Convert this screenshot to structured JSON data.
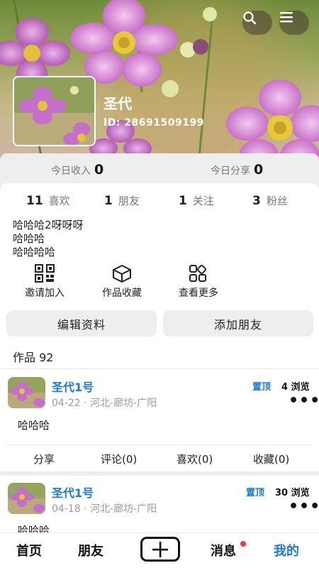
{
  "header": {
    "user_name": "圣代",
    "user_id": "ID: 28691509199",
    "icons": {
      "search": "search-icon",
      "menu": "hamburger-menu-icon"
    }
  },
  "stats": {
    "income_label": "今日收入",
    "income_value": "0",
    "share_label": "今日分享",
    "share_value": "0"
  },
  "counts": [
    {
      "value": "11",
      "label": "喜欢"
    },
    {
      "value": "1",
      "label": "朋友"
    },
    {
      "value": "1",
      "label": "关注"
    },
    {
      "value": "3",
      "label": "粉丝"
    }
  ],
  "bio": [
    "哈哈哈2呀呀呀",
    "哈哈哈",
    "哈哈哈哈"
  ],
  "actions": [
    {
      "label": "邀请加入",
      "icon": "qr-code-icon"
    },
    {
      "label": "作品收藏",
      "icon": "box-icon"
    },
    {
      "label": "查看更多",
      "icon": "grid-more-icon"
    }
  ],
  "buttons": {
    "edit": "编辑资料",
    "add_friend": "添加朋友"
  },
  "works": {
    "title": "作品 92"
  },
  "posts": [
    {
      "name": "圣代1号",
      "meta": "04-22 · 河北-廊坊-广阳",
      "pinned": "置顶",
      "views": "4 浏览",
      "body": "哈哈哈",
      "actions": [
        "分享",
        "评论(0)",
        "喜欢(0)",
        "收藏(0)"
      ]
    },
    {
      "name": "圣代1号",
      "meta": "04-18 · 河北-廊坊-广阳",
      "pinned": "置顶",
      "views": "30 浏览",
      "body": "哈哈哈"
    }
  ],
  "bottom_nav": {
    "home": "首页",
    "friends": "朋友",
    "publish_icon": "plus-icon",
    "messages": "消息",
    "me": "我的"
  },
  "colors": {
    "accent": "#1a7ad6",
    "badge": "#ef3b3b",
    "card_bg": "#eeeeee"
  }
}
